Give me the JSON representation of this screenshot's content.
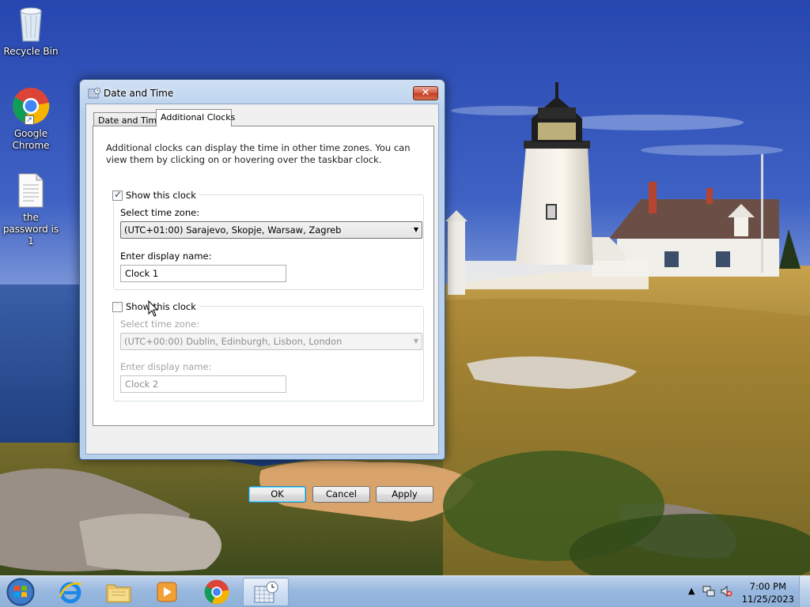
{
  "desktop": {
    "icons": [
      {
        "label": "Recycle Bin",
        "icon": "recycle-bin-icon"
      },
      {
        "label": "Google Chrome",
        "icon": "chrome-icon"
      },
      {
        "label": "the password is 1",
        "icon": "text-file-icon"
      }
    ]
  },
  "dialog": {
    "title": "Date and Time",
    "close_label": "✕",
    "tabs": [
      {
        "label": "Date and Time",
        "selected": false
      },
      {
        "label": "Additional Clocks",
        "selected": true
      }
    ],
    "intro": "Additional clocks can display the time in other time zones. You can view them by clicking on or hovering over the taskbar clock.",
    "clock1": {
      "show_label": "Show this clock",
      "checked": true,
      "timezone_label": "Select time zone:",
      "timezone_value": "(UTC+01:00) Sarajevo, Skopje, Warsaw, Zagreb",
      "name_label": "Enter display name:",
      "name_value": "Clock 1"
    },
    "clock2": {
      "show_label": "Show this clock",
      "checked": false,
      "timezone_label": "Select time zone:",
      "timezone_value": "(UTC+00:00) Dublin, Edinburgh, Lisbon, London",
      "name_label": "Enter display name:",
      "name_value": "Clock 2"
    },
    "buttons": {
      "ok": "OK",
      "cancel": "Cancel",
      "apply": "Apply"
    }
  },
  "taskbar": {
    "pinned": [
      "start-orb-icon",
      "internet-explorer-icon",
      "file-explorer-icon",
      "media-player-icon",
      "chrome-icon",
      "date-time-control-panel-icon"
    ],
    "tray": {
      "time": "7:00 PM",
      "date": "11/25/2023"
    }
  },
  "colors": {
    "window_frame": "#b9d1ec",
    "ok_focus": "#3c7fb1",
    "sky": "#3b5fb8"
  }
}
